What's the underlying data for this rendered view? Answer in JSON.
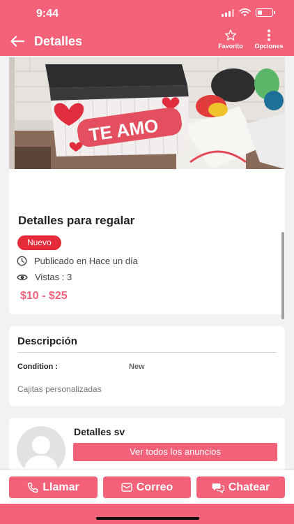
{
  "status_bar": {
    "time": "9:44"
  },
  "header": {
    "title": "Detalles",
    "favorite_label": "Favorito",
    "options_label": "Opciones"
  },
  "product": {
    "image_icon": "product-photo",
    "image_caption": "TE AMO",
    "title": "Detalles para regalar",
    "badge": "Nuevo",
    "published": "Publicado en Hace un día",
    "views": "Vistas : 3",
    "price": "$10 - $25"
  },
  "description": {
    "heading": "Descripción",
    "condition_label": "Condition :",
    "condition_value": "New",
    "text": "Cajitas personalizadas"
  },
  "seller": {
    "name": "Detalles sv",
    "all_ads_label": "Ver todos los anuncios"
  },
  "actions": {
    "call_label": "Llamar",
    "mail_label": "Correo",
    "chat_label": "Chatear"
  },
  "colors": {
    "accent": "#f4627a",
    "badge": "#e52b3a",
    "background": "#f2f2f4"
  }
}
